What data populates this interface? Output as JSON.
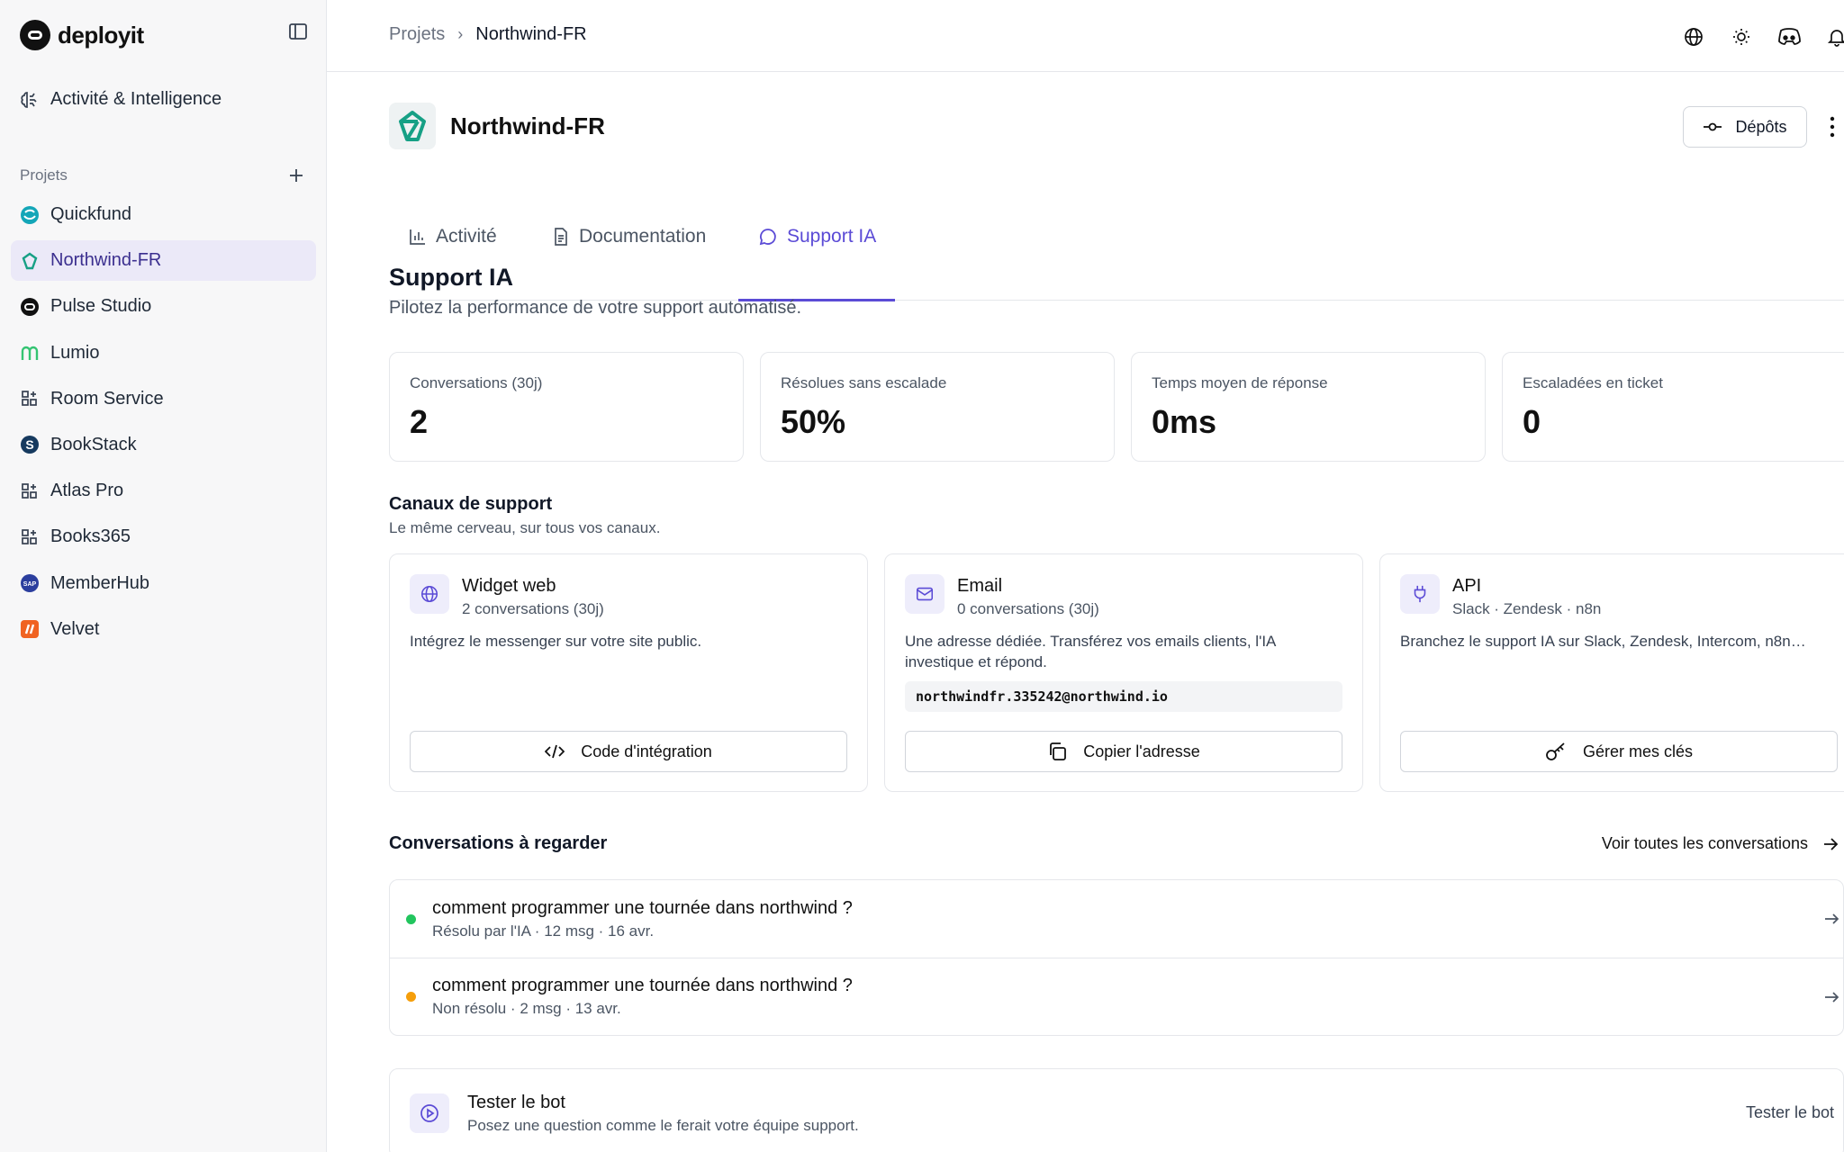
{
  "brand": {
    "name": "deployit"
  },
  "sidebar": {
    "activity_label": "Activité & Intelligence",
    "projects_label": "Projets",
    "projects": [
      {
        "name": "Quickfund",
        "icon": "quickfund-logo-icon",
        "active": false
      },
      {
        "name": "Northwind-FR",
        "icon": "northwind-logo-icon",
        "active": true
      },
      {
        "name": "Pulse Studio",
        "icon": "pulse-logo-icon",
        "active": false
      },
      {
        "name": "Lumio",
        "icon": "lumio-logo-icon",
        "active": false
      },
      {
        "name": "Room Service",
        "icon": "grid-plus-icon",
        "active": false
      },
      {
        "name": "BookStack",
        "icon": "bookstack-logo-icon",
        "active": false
      },
      {
        "name": "Atlas Pro",
        "icon": "grid-plus-icon",
        "active": false
      },
      {
        "name": "Books365",
        "icon": "grid-plus-icon",
        "active": false
      },
      {
        "name": "MemberHub",
        "icon": "sap-logo-icon",
        "active": false
      },
      {
        "name": "Velvet",
        "icon": "velvet-logo-icon",
        "active": false
      }
    ]
  },
  "breadcrumb": {
    "root": "Projets",
    "sep": "›",
    "current": "Northwind-FR"
  },
  "header": {
    "project_title": "Northwind-FR",
    "depots_label": "Dépôts"
  },
  "tabs": [
    {
      "label": "Activité",
      "icon": "bar-chart-icon"
    },
    {
      "label": "Documentation",
      "icon": "document-icon"
    },
    {
      "label": "Support IA",
      "icon": "chat-bubble-icon",
      "active": true
    }
  ],
  "section": {
    "title": "Support IA",
    "subtitle": "Pilotez la performance de votre support automatisé."
  },
  "stats": [
    {
      "label": "Conversations (30j)",
      "value": "2"
    },
    {
      "label": "Résolues sans escalade",
      "value": "50%"
    },
    {
      "label": "Temps moyen de réponse",
      "value": "0ms"
    },
    {
      "label": "Escaladées en ticket",
      "value": "0"
    }
  ],
  "channels": {
    "title": "Canaux de support",
    "subtitle": "Le même cerveau, sur tous vos canaux.",
    "items": [
      {
        "name": "Widget web",
        "meta": "2 conversations (30j)",
        "desc": "Intégrez le messenger sur votre site public.",
        "button": "Code d'intégration",
        "icon": "globe-icon"
      },
      {
        "name": "Email",
        "meta": "0 conversations (30j)",
        "desc": "Une adresse dédiée. Transférez vos emails clients, l'IA investique et répond.",
        "address": "northwindfr.335242@northwind.io",
        "button": "Copier l'adresse",
        "icon": "mail-icon"
      },
      {
        "name": "API",
        "meta": "Slack · Zendesk · n8n",
        "desc": "Branchez le support IA sur Slack, Zendesk, Intercom, n8n…",
        "button": "Gérer mes clés",
        "icon": "plug-icon"
      }
    ]
  },
  "conversations": {
    "title": "Conversations à regarder",
    "see_all": "Voir toutes les conversations",
    "items": [
      {
        "title": "comment programmer une tournée dans northwind ?",
        "meta": "Résolu par l'IA · 12 msg · 16 avr.",
        "status_color": "#22c55e"
      },
      {
        "title": "comment programmer une tournée dans northwind ?",
        "meta": "Non résolu · 2 msg · 13 avr.",
        "status_color": "#f59e0b"
      }
    ]
  },
  "test_bot": {
    "title": "Tester le bot",
    "subtitle": "Posez une question comme le ferait votre équipe support.",
    "link": "Tester le bot"
  },
  "colors": {
    "accent": "#5b4bd6",
    "active_bg": "#ebe9f8",
    "success": "#22c55e",
    "warning": "#f59e0b"
  }
}
